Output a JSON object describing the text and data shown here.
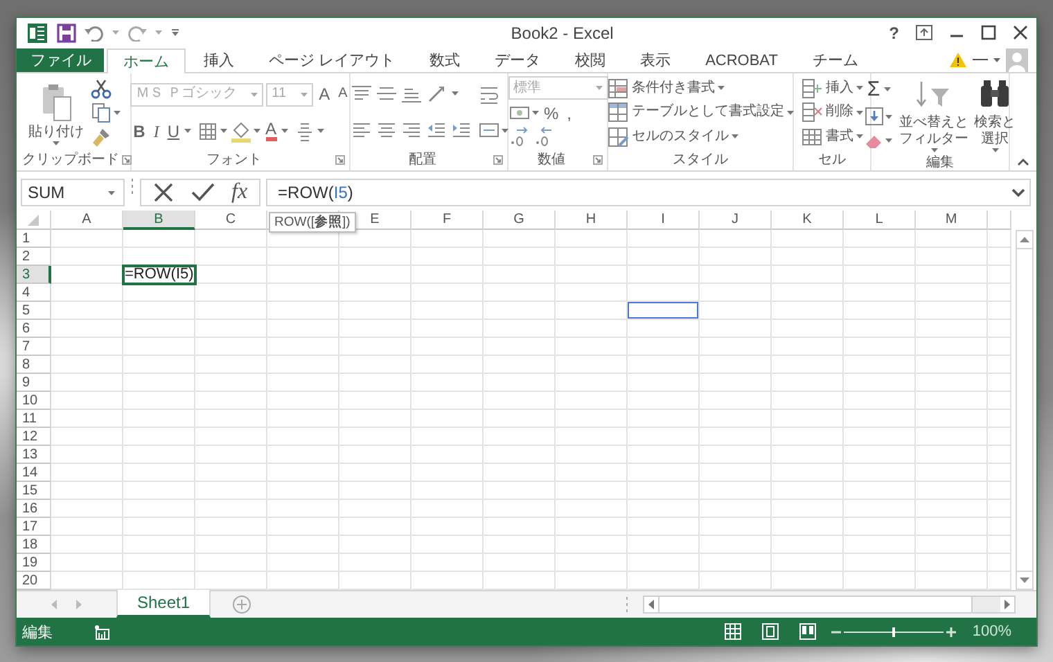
{
  "window": {
    "title": "Book2 - Excel",
    "help": "?"
  },
  "tabs": [
    {
      "label": "ファイル",
      "kind": "file",
      "selected": false
    },
    {
      "label": "ホーム",
      "kind": "tab",
      "selected": true
    },
    {
      "label": "挿入",
      "kind": "tab",
      "selected": false
    },
    {
      "label": "ページ レイアウト",
      "kind": "tab",
      "selected": false
    },
    {
      "label": "数式",
      "kind": "tab",
      "selected": false
    },
    {
      "label": "データ",
      "kind": "tab",
      "selected": false
    },
    {
      "label": "校閲",
      "kind": "tab",
      "selected": false
    },
    {
      "label": "表示",
      "kind": "tab",
      "selected": false
    },
    {
      "label": "ACROBAT",
      "kind": "tab",
      "selected": false
    },
    {
      "label": "チーム",
      "kind": "tab",
      "selected": false
    }
  ],
  "ribbon": {
    "groups": [
      {
        "label": "クリップボード",
        "launcher": true,
        "columns": [
          [
            [
              {
                "kind": "large",
                "lines": [
                  "貼り付け"
                ],
                "dropdown": true
              }
            ]
          ],
          [
            [
              {
                "kind": "icon"
              }
            ],
            [
              {
                "kind": "icon",
                "dropdown": true
              }
            ],
            [
              {
                "kind": "icon"
              }
            ]
          ]
        ]
      },
      {
        "label": "フォント",
        "launcher": true,
        "columns": [
          [
            [
              {
                "kind": "combo",
                "text": "ＭＳ Ｐゴシック",
                "disabled": true
              },
              {
                "kind": "combo",
                "text": "11",
                "disabled": true
              },
              {
                "kind": "glyph",
                "text": "A"
              },
              {
                "kind": "glyph",
                "text": "A"
              }
            ],
            [
              {
                "kind": "glyph",
                "text": "B"
              },
              {
                "kind": "glyph",
                "text": "I"
              },
              {
                "kind": "glyph",
                "text": "U",
                "dropdown": true
              },
              {
                "kind": "icon",
                "dropdown": true
              },
              {
                "kind": "icon",
                "dropdown": true
              },
              {
                "kind": "glyph",
                "text": "A",
                "dropdown": true
              },
              {
                "kind": "icon",
                "dropdown": true
              }
            ]
          ]
        ]
      },
      {
        "label": "配置",
        "launcher": true,
        "columns": [
          [
            [
              {
                "kind": "icon"
              },
              {
                "kind": "icon"
              },
              {
                "kind": "icon"
              },
              {
                "kind": "icon",
                "dropdown": true
              }
            ],
            [
              {
                "kind": "icon"
              },
              {
                "kind": "icon"
              },
              {
                "kind": "icon"
              },
              {
                "kind": "icon"
              },
              {
                "kind": "icon"
              }
            ]
          ],
          [
            [
              {
                "kind": "icon"
              }
            ],
            [
              {
                "kind": "icon",
                "dropdown": true
              }
            ]
          ]
        ]
      },
      {
        "label": "数値",
        "launcher": true,
        "columns": [
          [
            [
              {
                "kind": "combo",
                "text": "標準",
                "disabled": true
              }
            ],
            [
              {
                "kind": "icon",
                "dropdown": true
              },
              {
                "kind": "glyph",
                "text": "%"
              },
              {
                "kind": "glyph",
                "text": ","
              }
            ],
            [
              {
                "kind": "icon"
              },
              {
                "kind": "icon"
              }
            ]
          ]
        ]
      },
      {
        "label": "スタイル",
        "columns": [
          [
            [
              {
                "kind": "command",
                "text": "条件付き書式",
                "dropdown": true
              }
            ],
            [
              {
                "kind": "command",
                "text": "テーブルとして書式設定",
                "dropdown": true
              }
            ],
            [
              {
                "kind": "command",
                "text": "セルのスタイル",
                "dropdown": true
              }
            ]
          ]
        ]
      },
      {
        "label": "セル",
        "columns": [
          [
            [
              {
                "kind": "command",
                "text": "挿入",
                "dropdown": true
              }
            ],
            [
              {
                "kind": "command",
                "text": "削除",
                "dropdown": true
              }
            ],
            [
              {
                "kind": "command",
                "text": "書式",
                "dropdown": true
              }
            ]
          ]
        ]
      },
      {
        "label": "編集",
        "columns": [
          [
            [
              {
                "kind": "glyph",
                "text": "Σ",
                "dropdown": true
              }
            ],
            [
              {
                "kind": "icon",
                "dropdown": true
              }
            ],
            [
              {
                "kind": "icon",
                "dropdown": true
              }
            ]
          ],
          [
            [
              {
                "kind": "large",
                "lines": [
                  "並べ替えと",
                  "フィルター"
                ],
                "dropdown": true
              }
            ]
          ],
          [
            [
              {
                "kind": "large",
                "lines": [
                  "検索と",
                  "選択"
                ],
                "dropdown": true
              }
            ]
          ]
        ]
      }
    ]
  },
  "formula_bar": {
    "name_box": "SUM",
    "function_button": "fx",
    "formula": [
      {
        "text": "=ROW(",
        "kind": "plain"
      },
      {
        "text": "I5",
        "kind": "reference"
      },
      {
        "text": ")",
        "kind": "plain"
      }
    ]
  },
  "tooltip": "ROW([**参照**])",
  "grid": {
    "columns": [
      {
        "label": "A",
        "selected": false
      },
      {
        "label": "B",
        "selected": true
      },
      {
        "label": "C",
        "selected": false
      },
      {
        "selected": false
      },
      {
        "label": "E",
        "selected": false
      },
      {
        "label": "F",
        "selected": false
      },
      {
        "label": "G",
        "selected": false
      },
      {
        "label": "H",
        "selected": false
      },
      {
        "label": "I",
        "selected": false
      },
      {
        "label": "J",
        "selected": false
      },
      {
        "label": "K",
        "selected": false
      },
      {
        "label": "L",
        "selected": false
      },
      {
        "label": "M",
        "selected": false
      }
    ],
    "rows": [
      {
        "label": "1",
        "selected": false
      },
      {
        "label": "2",
        "selected": false
      },
      {
        "label": "3",
        "selected": true,
        "cells": [
          {
            "kind": "empty",
            "selected": false
          },
          {
            "kind": "text",
            "text": "=ROW(I5)",
            "selected": true
          }
        ]
      },
      {
        "label": "4",
        "selected": false
      },
      {
        "label": "5",
        "selected": false,
        "cells": [
          {
            "kind": "empty",
            "selected": false
          },
          {
            "kind": "empty",
            "selected": false
          },
          {
            "kind": "empty",
            "selected": false
          },
          {
            "kind": "empty",
            "selected": false
          },
          {
            "kind": "empty",
            "selected": false
          },
          {
            "kind": "empty",
            "selected": false
          },
          {
            "kind": "empty",
            "selected": false
          },
          {
            "kind": "empty",
            "selected": false
          },
          {
            "kind": "reference",
            "selected": false
          }
        ]
      },
      {
        "label": "6",
        "selected": false
      },
      {
        "label": "7",
        "selected": false
      },
      {
        "label": "8",
        "selected": false
      },
      {
        "label": "9",
        "selected": false
      },
      {
        "label": "10",
        "selected": false
      },
      {
        "label": "11",
        "selected": false
      },
      {
        "label": "12",
        "selected": false
      },
      {
        "label": "13",
        "selected": false
      },
      {
        "label": "14",
        "selected": false
      },
      {
        "label": "15",
        "selected": false
      },
      {
        "label": "16",
        "selected": false
      },
      {
        "label": "17",
        "selected": false
      },
      {
        "label": "18",
        "selected": false
      },
      {
        "label": "19",
        "selected": false
      },
      {
        "label": "20",
        "selected": false
      }
    ]
  },
  "sheet_tabs": [
    {
      "label": "Sheet1",
      "selected": true
    }
  ],
  "status_bar": {
    "mode": "編集",
    "zoom_slider": {
      "level": 0.5
    },
    "zoom": "100%"
  }
}
